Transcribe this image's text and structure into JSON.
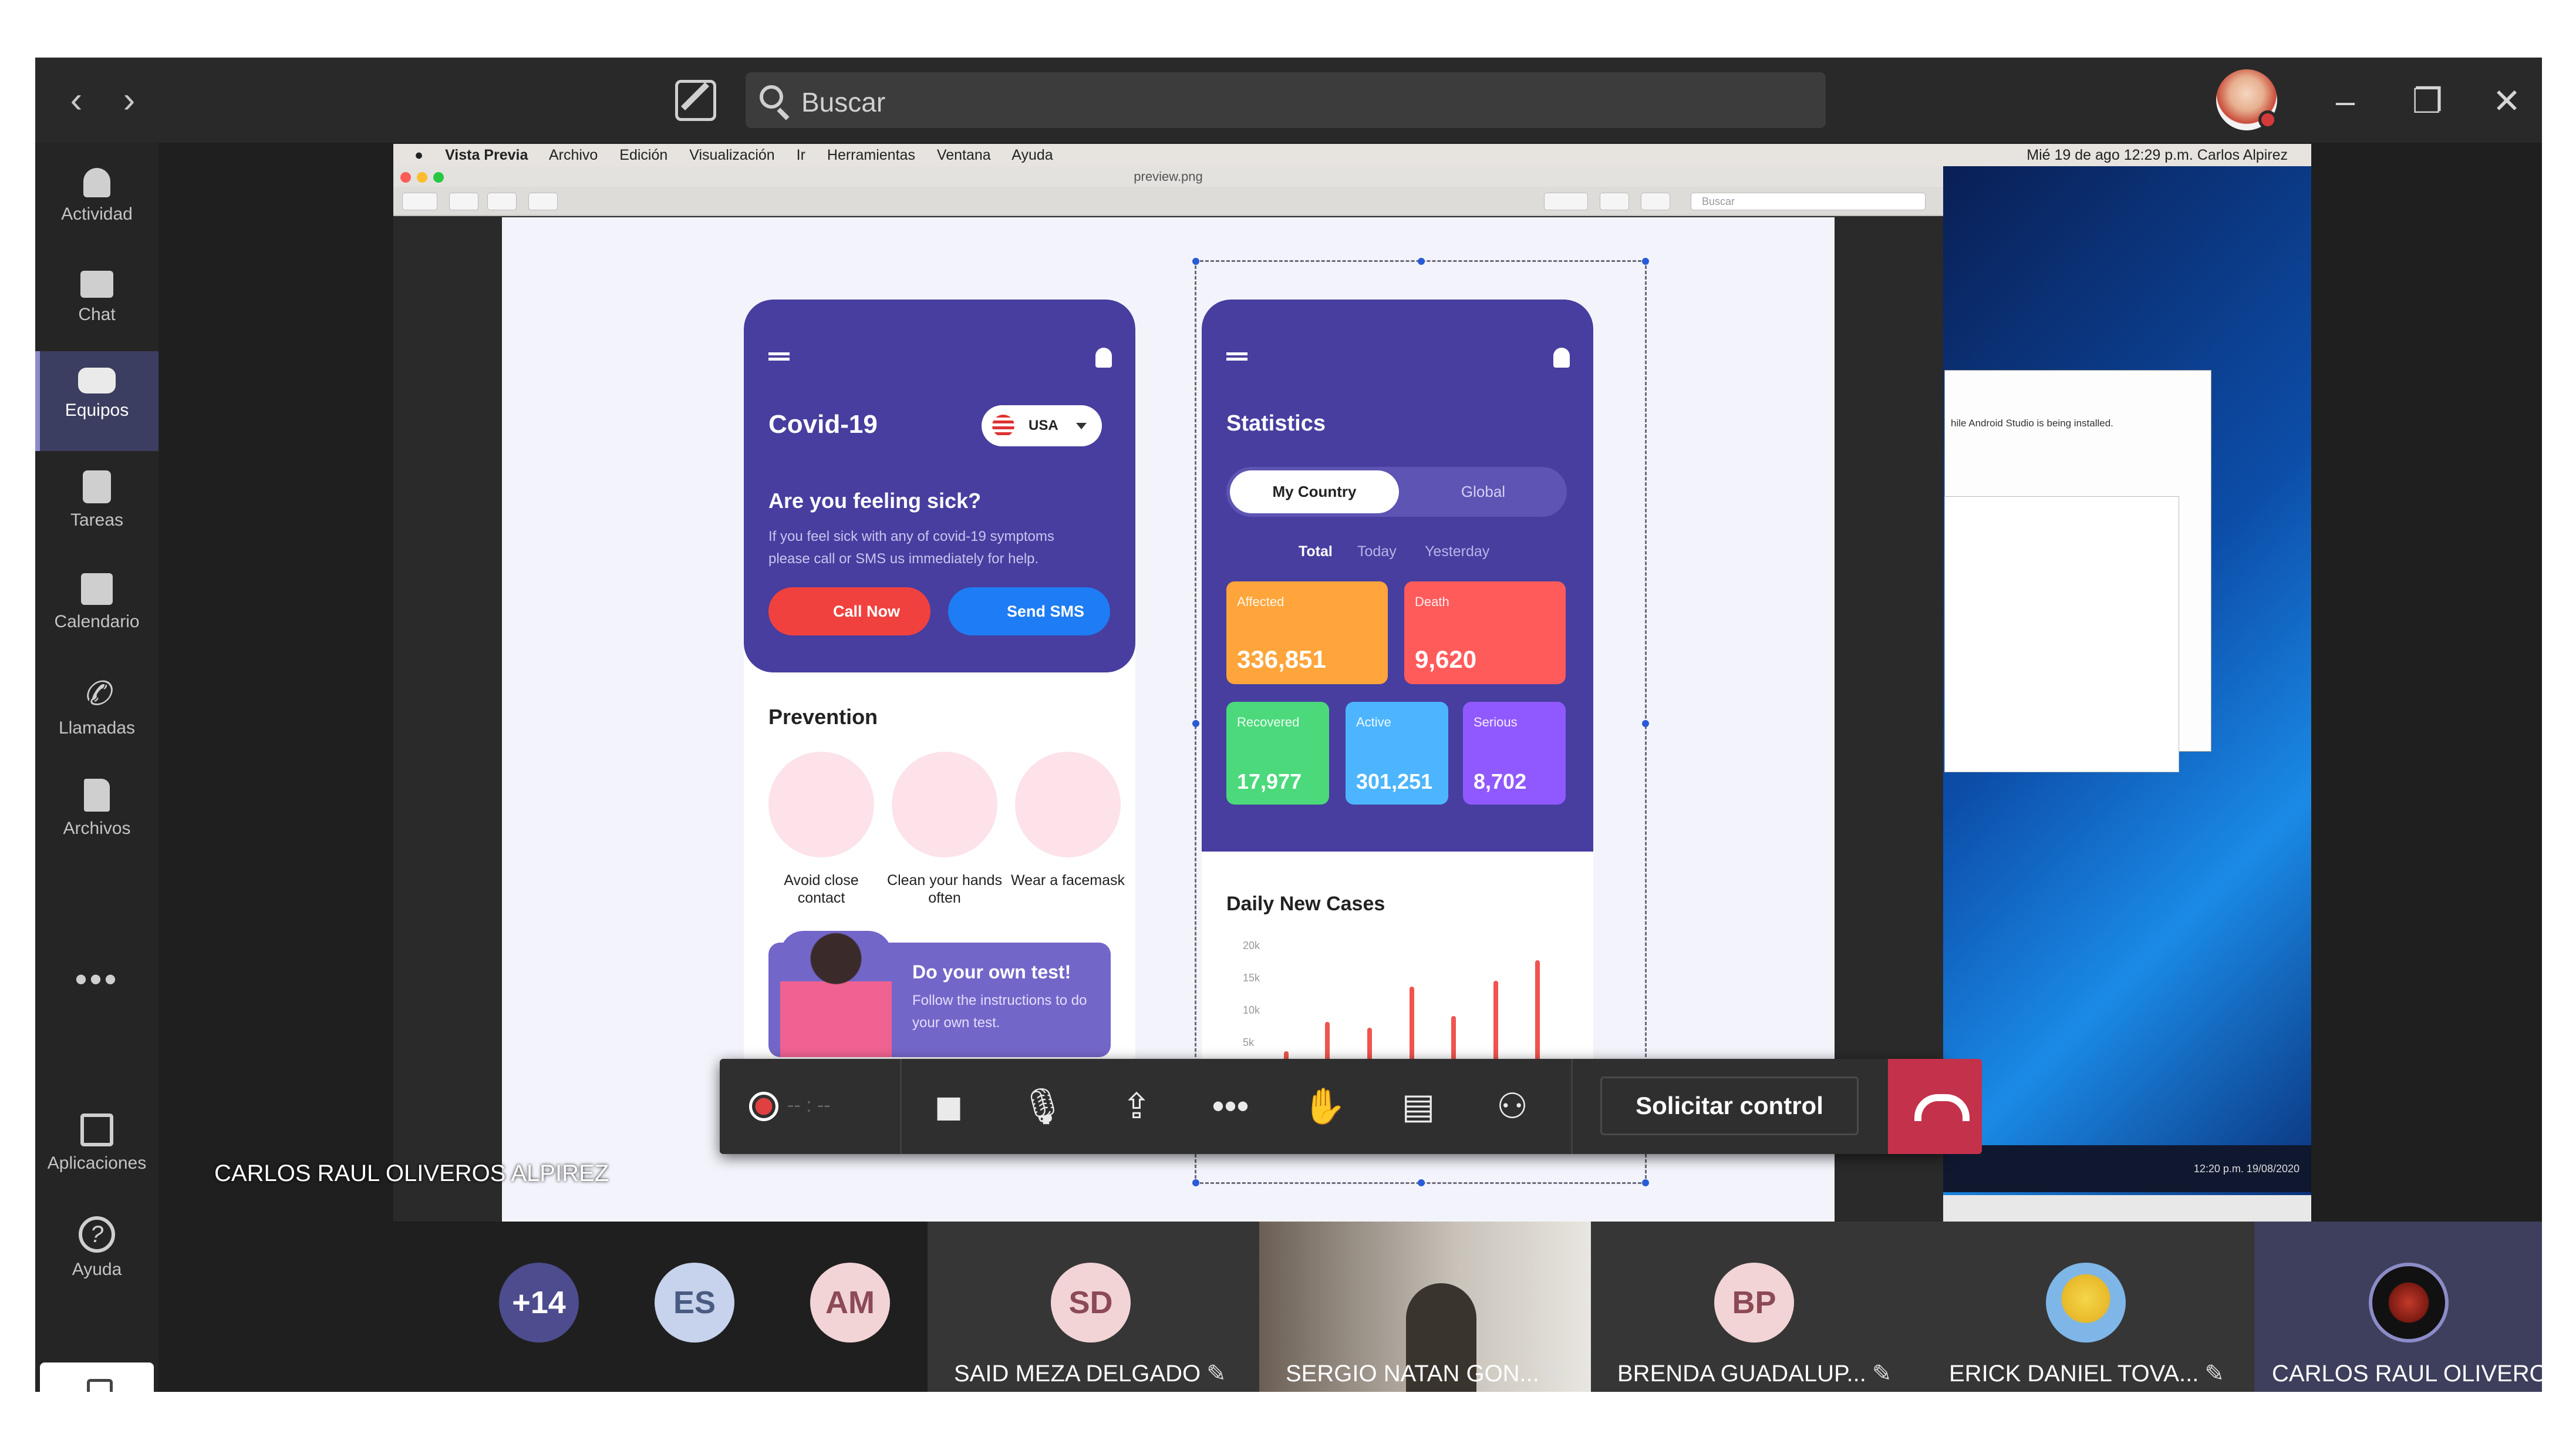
{
  "topbar": {
    "back_icon": "‹",
    "forward_icon": "›",
    "search_placeholder": "Buscar",
    "minimize": "–",
    "restore": "❐",
    "close": "✕"
  },
  "rail": {
    "items": [
      {
        "label": "Actividad",
        "icon": "bell-icon"
      },
      {
        "label": "Chat",
        "icon": "chat-icon"
      },
      {
        "label": "Equipos",
        "icon": "teams-icon"
      },
      {
        "label": "Tareas",
        "icon": "tasks-icon"
      },
      {
        "label": "Calendario",
        "icon": "calendar-icon"
      },
      {
        "label": "Llamadas",
        "icon": "phone-icon"
      },
      {
        "label": "Archivos",
        "icon": "files-icon"
      }
    ],
    "more": "•••",
    "apps_label": "Aplicaciones",
    "help_label": "Ayuda",
    "help_glyph": "?"
  },
  "mac": {
    "menus": [
      "Vista Previa",
      "Archivo",
      "Edición",
      "Visualización",
      "Ir",
      "Herramientas",
      "Ventana",
      "Ayuda"
    ],
    "status": "Mié 19 de ago  12:29 p.m.    Carlos Alpirez",
    "window_title": "preview.png",
    "search_placeholder": "Buscar"
  },
  "phone1": {
    "title": "Covid-19",
    "country": "USA",
    "question": "Are you feeling sick?",
    "body": "If you feel sick with any of covid-19 symptoms please call or SMS us immediately for help.",
    "call_label": "Call Now",
    "sms_label": "Send SMS",
    "prevention_title": "Prevention",
    "prevention_items": [
      "Avoid close contact",
      "Clean your hands often",
      "Wear a facemask"
    ],
    "test_title": "Do your own test!",
    "test_body": "Follow the instructions to do your own test."
  },
  "phone2": {
    "title": "Statistics",
    "tabs": [
      "My Country",
      "Global"
    ],
    "subtabs": [
      "Total",
      "Today",
      "Yesterday"
    ],
    "stats": [
      {
        "label": "Affected",
        "value": "336,851",
        "color": "#ffa53b"
      },
      {
        "label": "Death",
        "value": "9,620",
        "color": "#ff5b5b"
      },
      {
        "label": "Recovered",
        "value": "17,977",
        "color": "#4cd97b"
      },
      {
        "label": "Active",
        "value": "301,251",
        "color": "#4db5ff"
      },
      {
        "label": "Serious",
        "value": "8,702",
        "color": "#9059ff"
      }
    ],
    "daily_title": "Daily New Cases",
    "y_ticks": [
      "20k",
      "15k",
      "10k",
      "5k"
    ]
  },
  "windows_dialog": {
    "text": "hile Android Studio is being installed.",
    "taskbar": "12:20 p.m.  19/08/2020"
  },
  "controls": {
    "timer": "-- : --",
    "request_control": "Solicitar control"
  },
  "presenter_name": "CARLOS RAUL OLIVEROS ALPIREZ",
  "participants": {
    "overflow": "+14",
    "avatars": [
      "ES",
      "AM"
    ],
    "tiles": [
      {
        "initials": "SD",
        "name": "SAID MEZA DELGADO"
      },
      {
        "initials": "",
        "name": "SERGIO NATAN GON..."
      },
      {
        "initials": "BP",
        "name": "BRENDA GUADALUP..."
      },
      {
        "initials": "",
        "name": "ERICK DANIEL TOVA..."
      },
      {
        "initials": "",
        "name": "CARLOS RAUL OLIVEROS ..."
      }
    ],
    "muted_icon": "🎙̸"
  },
  "colors": {
    "teams_accent": "#8b8cc7",
    "phone_purple": "#473e9f",
    "hangup": "#c4314b"
  }
}
